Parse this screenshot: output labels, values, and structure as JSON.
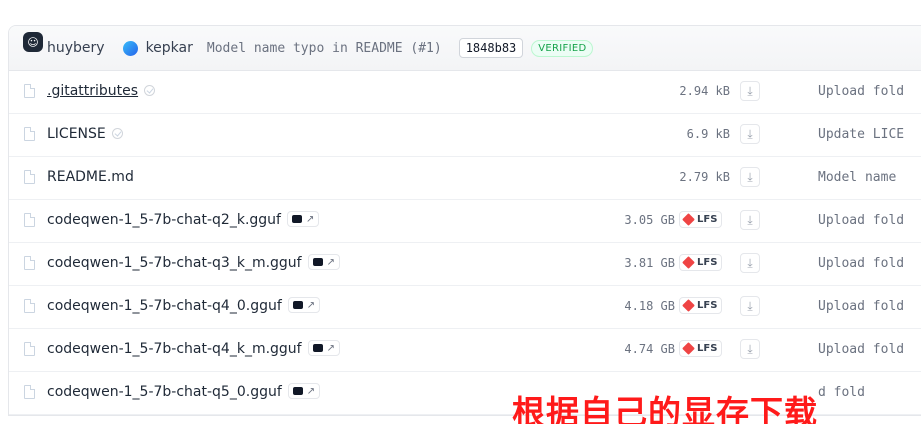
{
  "commit": {
    "avatar_glyph": "☺",
    "author1": "huybery",
    "author2": "kepkar",
    "message": "Model name typo in README (#1)",
    "sha": "1848b83",
    "verified": "VERIFIED"
  },
  "files": [
    {
      "name": ".gitattributes",
      "size": "2.94 kB",
      "commit": "Upload fold",
      "lfs": false,
      "gguf": false,
      "safe": true,
      "underline": true
    },
    {
      "name": "LICENSE",
      "size": "6.9 kB",
      "commit": "Update LICE",
      "lfs": false,
      "gguf": false,
      "safe": true
    },
    {
      "name": "README.md",
      "size": "2.79 kB",
      "commit": "Model name ",
      "lfs": false,
      "gguf": false
    },
    {
      "name": "codeqwen-1_5-7b-chat-q2_k.gguf",
      "size": "3.05 GB",
      "commit": "Upload fold",
      "lfs": true,
      "gguf": true
    },
    {
      "name": "codeqwen-1_5-7b-chat-q3_k_m.gguf",
      "size": "3.81 GB",
      "commit": "Upload fold",
      "lfs": true,
      "gguf": true
    },
    {
      "name": "codeqwen-1_5-7b-chat-q4_0.gguf",
      "size": "4.18 GB",
      "commit": "Upload fold",
      "lfs": true,
      "gguf": true
    },
    {
      "name": "codeqwen-1_5-7b-chat-q4_k_m.gguf",
      "size": "4.74 GB",
      "commit": "Upload fold",
      "lfs": true,
      "gguf": true
    },
    {
      "name": "codeqwen-1_5-7b-chat-q5_0.gguf",
      "size": "",
      "commit": "d fold",
      "lfs": false,
      "gguf": true
    }
  ],
  "labels": {
    "lfs": "LFS",
    "gguf_arrow": "↗",
    "download_arrow": "⤓"
  },
  "overlay_text": "根据自己的显存下载",
  "colors": {
    "overlay": "#ff1a1a",
    "verified": "#16a34a",
    "lfs_cube": "#ef4444"
  }
}
